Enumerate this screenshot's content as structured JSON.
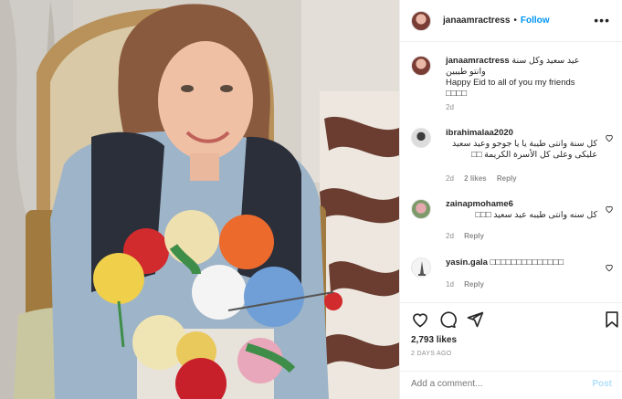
{
  "header": {
    "username": "janaamractress",
    "separator": "•",
    "follow_label": "Follow",
    "more_label": "•••"
  },
  "caption": {
    "username": "janaamractress",
    "text_ar": "عيد سعيد وكل سنة وانتو طيبين",
    "text_en": "Happy Eid to all of you my friends □□□□",
    "time": "2d"
  },
  "comments": [
    {
      "username": "ibrahimalaa2020",
      "text": "كل سنة وانتى طيبة يا يا جوجو وعيد سعيد عليكى وعلى كل الأسرة الكريمة □□",
      "time": "2d",
      "likes": "2 likes",
      "reply": "Reply"
    },
    {
      "username": "zainapmohame6",
      "text": "كل سنه وانتى طيبه عيد سعيد □□□",
      "time": "2d",
      "reply": "Reply"
    },
    {
      "username": "yasin.gala",
      "text": "□□□□□□□□□□□□□□",
      "time": "1d",
      "reply": "Reply"
    }
  ],
  "post": {
    "likes": "2,793 likes",
    "age": "2 DAYS AGO"
  },
  "add_comment": {
    "placeholder": "Add a comment...",
    "post_label": "Post"
  },
  "colors": {
    "accent": "#0095f6",
    "post_disabled": "#b2dffc",
    "muted": "#8e8e8e",
    "text": "#262626"
  }
}
